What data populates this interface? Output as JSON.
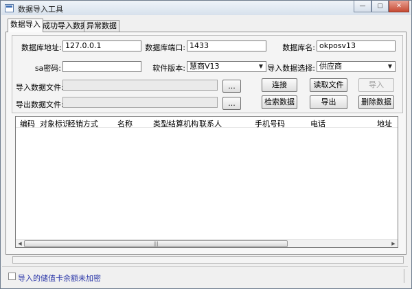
{
  "window": {
    "title": "数据导入工具",
    "controls": {
      "minimize": "—",
      "maximize": "▢",
      "close": "✕"
    }
  },
  "tabs": [
    {
      "label": "数据导入"
    },
    {
      "label": "成功导入数据"
    },
    {
      "label": "异常数据"
    }
  ],
  "form": {
    "db_address_label": "数据库地址:",
    "db_address_value": "127.0.0.1",
    "db_port_label": "数据库端口:",
    "db_port_value": "1433",
    "db_name_label": "数据库名:",
    "db_name_value": "okposv13",
    "sa_password_label": "sa密码:",
    "sa_password_value": "",
    "software_version_label": "软件版本:",
    "software_version_value": "慧商V13",
    "import_select_label": "导入数据选择:",
    "import_select_value": "供应商",
    "import_file_label": "导入数据文件:",
    "import_file_value": "",
    "export_file_label": "导出数据文件:",
    "export_file_value": "",
    "browse_label": "...",
    "buttons": {
      "connect": "连接",
      "read_file": "读取文件",
      "import": "导入",
      "search": "检索数据",
      "export": "导出",
      "delete": "删除数据"
    }
  },
  "table": {
    "columns": [
      "编码",
      "对象标识",
      "经销方式",
      "名称",
      "类型",
      "结算机构",
      "联系人",
      "手机号码",
      "电话",
      "地址"
    ],
    "rows": [],
    "scroll_thumb_grip": "|||"
  },
  "progress": {
    "value": 0.0
  },
  "footer": {
    "checkbox_label": "导入的储值卡余额未加密",
    "checked": false
  }
}
